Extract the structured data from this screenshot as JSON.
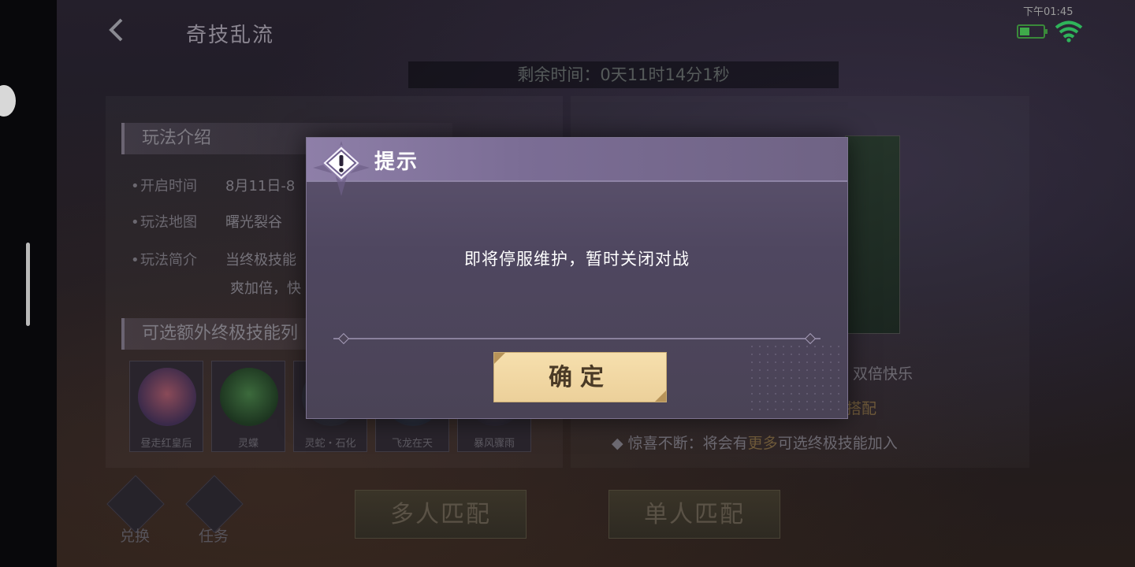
{
  "status_bar": {
    "time": "下午01:45",
    "colors": {
      "battery": "#3fa94a",
      "wifi": "#2fb35a"
    }
  },
  "header": {
    "back_icon": "chevron-left-icon",
    "title": "奇技乱流"
  },
  "timer": {
    "text": "剩余时间：0天11时14分1秒"
  },
  "intro": {
    "section_title": "玩法介绍",
    "rows": [
      {
        "key": "开启时间",
        "value": "8月11日-8"
      },
      {
        "key": "玩法地图",
        "value": "曙光裂谷"
      },
      {
        "key": "玩法简介",
        "value": "当终极技能",
        "value_line2": "爽加倍，快"
      }
    ]
  },
  "skills": {
    "section_title": "可选额外终极技能列",
    "items": [
      {
        "name": "昼走红皇后"
      },
      {
        "name": "灵蝶"
      },
      {
        "name": "灵蛇・石化"
      },
      {
        "name": "飞龙在天"
      },
      {
        "name": "暴风骤雨"
      }
    ]
  },
  "right_info": {
    "line1": "双倍快乐",
    "line2_suffix": "搭配",
    "line3_prefix": "惊喜不断：将会有",
    "line3_highlight": "更多",
    "line3_suffix": "可选终极技能加入"
  },
  "bottom": {
    "exchange_label": "兑换",
    "task_label": "任务",
    "multi_match": "多人匹配",
    "single_match": "单人匹配"
  },
  "dialog": {
    "title": "提示",
    "message": "即将停服维护，暂时关闭对战",
    "confirm": "确定",
    "icon": "alert-icon",
    "colors": {
      "header": "#8e7fa8",
      "body": "#524a63",
      "button": "#f1d7a2"
    }
  }
}
